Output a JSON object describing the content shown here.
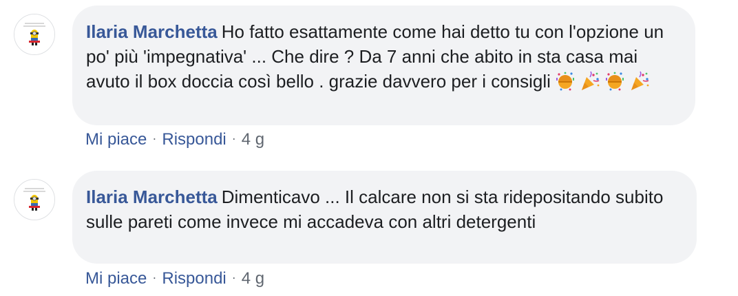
{
  "comments": [
    {
      "author": "Ilaria Marchetta",
      "body": "Ho fatto esattamente come hai detto tu con l'opzione un po' più 'impegnativa' ... Che dire ? Da 7 anni che abito in sta casa mai avuto il box doccia così bello . grazie davvero per i consigli",
      "emojis": [
        "confetti-ball-icon",
        "party-popper-icon",
        "confetti-ball-icon",
        "party-popper-icon"
      ],
      "like_label": "Mi piace",
      "reply_label": "Rispondi",
      "separator": "·",
      "timestamp": "4 g"
    },
    {
      "author": "Ilaria Marchetta",
      "body": "Dimenticavo ... Il calcare non si sta ridepositando subito sulle pareti come invece mi accadeva con altri detergenti",
      "emojis": [],
      "like_label": "Mi piace",
      "reply_label": "Rispondi",
      "separator": "·",
      "timestamp": "4 g"
    }
  ],
  "colors": {
    "author": "#385898",
    "bubble": "#f2f3f5",
    "text": "#1c1e21",
    "meta": "#606770"
  }
}
